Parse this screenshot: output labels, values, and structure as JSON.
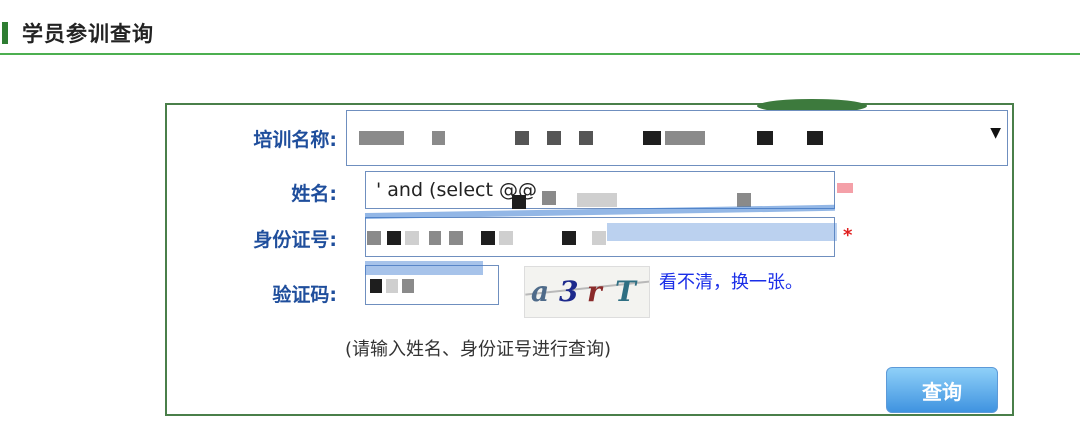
{
  "header": {
    "title": "学员参训查询"
  },
  "form": {
    "training_name": {
      "label": "培训名称:",
      "value": "",
      "required": false
    },
    "name": {
      "label": "姓名:",
      "value": "' and (select @@",
      "required": true
    },
    "id_number": {
      "label": "身份证号:",
      "value": "",
      "required": true,
      "required_mark": "*"
    },
    "captcha": {
      "label": "验证码:",
      "image_text": "a3rT",
      "input_value": ""
    },
    "refresh_link": "看不清，换一张。",
    "hint": "(请输入姓名、身份证号进行查询)",
    "submit_label": "查询"
  },
  "colors": {
    "accent_green": "#4caf50",
    "label_blue": "#1f4e9c",
    "link_blue": "#1a2ee8",
    "button_blue": "#3f93e0",
    "required_red": "#e02020"
  }
}
